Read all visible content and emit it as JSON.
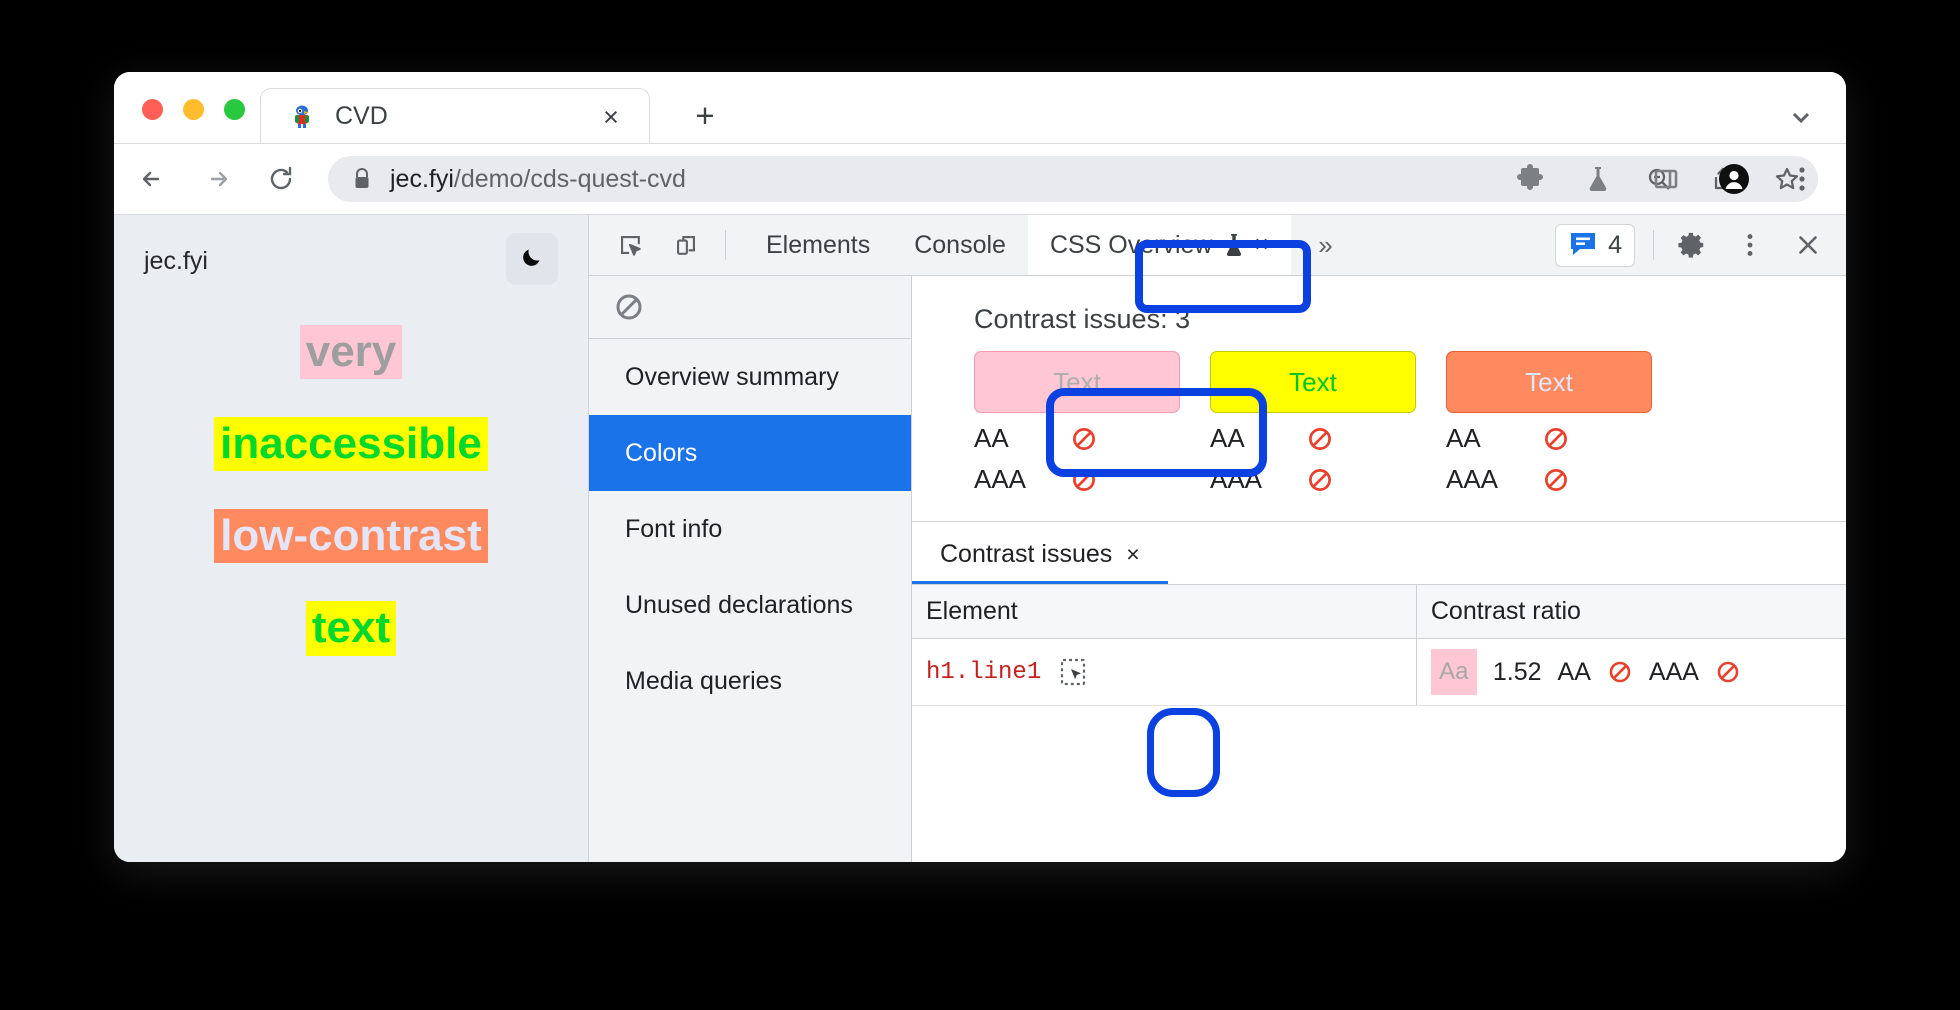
{
  "browser": {
    "traffic_lights": [
      "close",
      "minimize",
      "maximize"
    ],
    "tab": {
      "title": "CVD",
      "favicon": "parrot-favicon",
      "close_label": "×"
    },
    "new_tab_label": "+",
    "tab_search_icon": "chevron-down-icon",
    "nav": {
      "back_icon": "arrow-left-icon",
      "forward_icon": "arrow-right-icon",
      "reload_icon": "reload-icon"
    },
    "omnibox": {
      "lock_icon": "lock-icon",
      "url_host": "jec.fyi",
      "url_path": "/demo/cds-quest-cvd",
      "actions": [
        "zoom-out-icon",
        "share-icon",
        "bookmark-star-icon"
      ]
    },
    "toolbar_icons": [
      "extensions-puzzle-icon",
      "flask-icon",
      "side-panel-icon",
      "profile-avatar-icon",
      "chrome-menu-icon"
    ]
  },
  "page": {
    "brand": "jec.fyi",
    "theme_toggle_icon": "moon-icon",
    "lines": [
      {
        "text": "very",
        "bg": "#ffc6d3",
        "fg": "#9e9e9e"
      },
      {
        "text": "inaccessible",
        "bg": "#ffff00",
        "fg": "#00d92b"
      },
      {
        "text": "low-contrast",
        "bg": "#ff8a5f",
        "fg": "#e4e5f7"
      },
      {
        "text": "text",
        "bg": "#ffff00",
        "fg": "#00d92b"
      }
    ]
  },
  "devtools": {
    "inspect_icon": "inspect-element-icon",
    "device_icon": "device-toolbar-icon",
    "tabs": [
      {
        "label": "Elements",
        "active": false
      },
      {
        "label": "Console",
        "active": false
      },
      {
        "label": "CSS Overview",
        "active": true,
        "icon": "flask-icon",
        "close_label": "×"
      }
    ],
    "more_tabs_label": "»",
    "issues_count": "4",
    "issues_icon": "issues-bubble-icon",
    "settings_icon": "gear-icon",
    "menu_icon": "more-vertical-icon",
    "close_icon": "close-icon"
  },
  "css_overview": {
    "clear_icon": "no-entry-icon",
    "sidebar": [
      {
        "label": "Overview summary",
        "selected": false
      },
      {
        "label": "Colors",
        "selected": true
      },
      {
        "label": "Font info",
        "selected": false
      },
      {
        "label": "Unused declarations",
        "selected": false
      },
      {
        "label": "Media queries",
        "selected": false
      }
    ],
    "contrast": {
      "heading": "Contrast issues: 3",
      "swatches": [
        {
          "text": "Text",
          "bg": "#ffc6d3",
          "fg": "#aeaeae",
          "border": "#f39bb0",
          "aa_label": "AA",
          "aa_status": "fail",
          "aaa_label": "AAA",
          "aaa_status": "fail"
        },
        {
          "text": "Text",
          "bg": "#ffff00",
          "fg": "#00c425",
          "border": "#c8c800",
          "aa_label": "AA",
          "aa_status": "fail",
          "aaa_label": "AAA",
          "aaa_status": "fail"
        },
        {
          "text": "Text",
          "bg": "#ff8a5f",
          "fg": "#dfe6f5",
          "border": "#e8603a",
          "aa_label": "AA",
          "aa_status": "fail",
          "aaa_label": "AAA",
          "aaa_status": "fail"
        }
      ]
    },
    "issues_panel": {
      "tab_label": "Contrast issues",
      "tab_close": "×",
      "columns": [
        "Element",
        "Contrast ratio"
      ],
      "rows": [
        {
          "element": "h1.line1",
          "pick_icon": "select-element-icon",
          "swatch_label": "Aa",
          "swatch_bg": "#ffc6d3",
          "swatch_fg": "#a8a8a8",
          "ratio": "1.52",
          "aa_label": "AA",
          "aa_status": "fail",
          "aaa_label": "AAA",
          "aaa_status": "fail"
        }
      ]
    }
  },
  "annotations": {
    "accent": "#0b41e0",
    "rings": [
      "css-overview-tab",
      "first-contrast-swatch",
      "select-element-button"
    ]
  }
}
